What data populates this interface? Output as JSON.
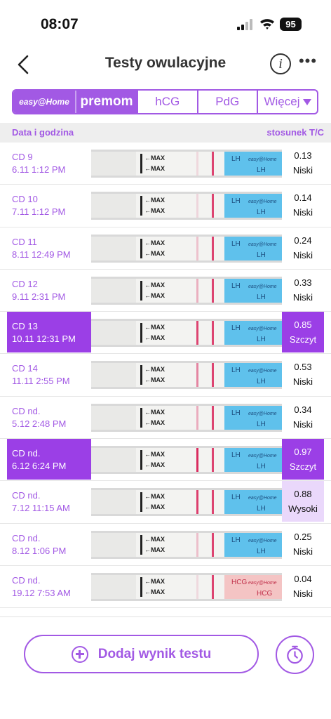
{
  "status_bar": {
    "time": "08:07",
    "battery": "95"
  },
  "header": {
    "title": "Testy owulacyjne",
    "info_icon": "info-icon",
    "more_icon": "more-icon"
  },
  "tabs": [
    {
      "label": "easy@Home",
      "selected": true
    },
    {
      "label": "premom",
      "selected": true
    },
    {
      "label": "hCG"
    },
    {
      "label": "PdG"
    },
    {
      "label": "Więcej"
    }
  ],
  "columns": {
    "left": "Data i godzina",
    "right": "stosunek T/C"
  },
  "rows": [
    {
      "day": "CD 9",
      "datetime": "6.11 1:12 PM",
      "ratio": "0.13",
      "level": "Niski",
      "state": "low",
      "strip": "LH",
      "test_line": 0.13
    },
    {
      "day": "CD 10",
      "datetime": "7.11 1:12 PM",
      "ratio": "0.14",
      "level": "Niski",
      "state": "low",
      "strip": "LH",
      "test_line": 0.14
    },
    {
      "day": "CD 11",
      "datetime": "8.11 12:49 PM",
      "ratio": "0.24",
      "level": "Niski",
      "state": "low",
      "strip": "LH",
      "test_line": 0.24
    },
    {
      "day": "CD 12",
      "datetime": "9.11 2:31 PM",
      "ratio": "0.33",
      "level": "Niski",
      "state": "low",
      "strip": "LH",
      "test_line": 0.33
    },
    {
      "day": "CD 13",
      "datetime": "10.11 12:31 PM",
      "ratio": "0.85",
      "level": "Szczyt",
      "state": "peak",
      "strip": "LH",
      "test_line": 0.85
    },
    {
      "day": "CD 14",
      "datetime": "11.11 2:55 PM",
      "ratio": "0.53",
      "level": "Niski",
      "state": "low",
      "strip": "LH",
      "test_line": 0.53
    },
    {
      "day": "CD nd.",
      "datetime": "5.12 2:48 PM",
      "ratio": "0.34",
      "level": "Niski",
      "state": "low",
      "strip": "LH",
      "test_line": 0.34
    },
    {
      "day": "CD nd.",
      "datetime": "6.12 6:24 PM",
      "ratio": "0.97",
      "level": "Szczyt",
      "state": "peak",
      "strip": "LH",
      "test_line": 0.97
    },
    {
      "day": "CD nd.",
      "datetime": "7.12 11:15 AM",
      "ratio": "0.88",
      "level": "Wysoki",
      "state": "high",
      "strip": "LH",
      "test_line": 0.88
    },
    {
      "day": "CD nd.",
      "datetime": "8.12 1:06 PM",
      "ratio": "0.25",
      "level": "Niski",
      "state": "low",
      "strip": "LH",
      "test_line": 0.25
    },
    {
      "day": "CD nd.",
      "datetime": "19.12 7:53 AM",
      "ratio": "0.04",
      "level": "Niski",
      "state": "low",
      "strip": "HCG",
      "test_line": 0.04
    }
  ],
  "strip_text": {
    "max": "MAX",
    "brand": "easy@Home"
  },
  "colors": {
    "accent": "#a259e4",
    "peak": "#9b3fe6",
    "high": "#ead8fb",
    "lh_blue": "#5fc1ec",
    "hcg_pink": "#f4c4c4",
    "line_red": "#d8245a"
  },
  "footer": {
    "add_label": "Dodaj wynik testu",
    "plus_icon": "plus-circle-icon",
    "timer_icon": "timer-icon"
  }
}
